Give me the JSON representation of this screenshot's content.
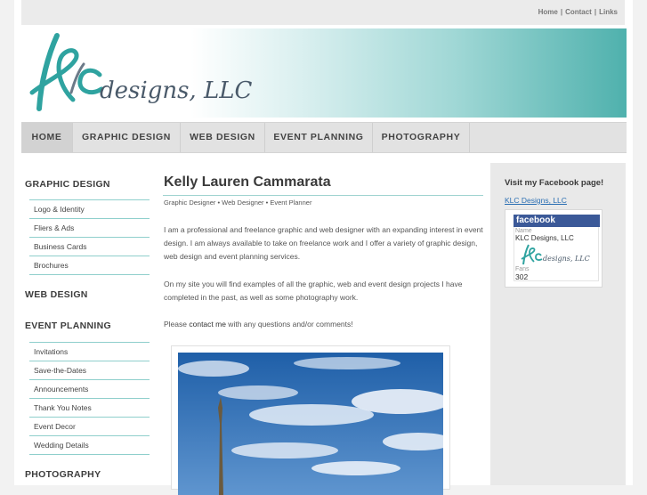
{
  "top_links": [
    "Home",
    "Contact",
    "Links"
  ],
  "logo": {
    "text": "designs, LLC",
    "letters": "KLC"
  },
  "colors": {
    "accent": "#3aa7a3",
    "facebook": "#3b5998",
    "link": "#2b6fb3"
  },
  "nav": [
    "HOME",
    "GRAPHIC DESIGN",
    "WEB DESIGN",
    "EVENT PLANNING",
    "PHOTOGRAPHY"
  ],
  "sidebar": {
    "graphic_design": {
      "heading": "GRAPHIC DESIGN",
      "items": [
        "Logo & Identity",
        "Fliers & Ads",
        "Business Cards",
        "Brochures"
      ]
    },
    "web_design": {
      "heading": "WEB DESIGN"
    },
    "event_planning": {
      "heading": "EVENT PLANNING",
      "items": [
        "Invitations",
        "Save-the-Dates",
        "Announcements",
        "Thank You Notes",
        "Event Decor",
        "Wedding Details"
      ]
    },
    "photography": {
      "heading": "PHOTOGRAPHY"
    }
  },
  "main": {
    "title": "Kelly Lauren Cammarata",
    "subtitle": "Graphic Designer • Web Designer • Event Planner",
    "para1": "I am a professional and freelance graphic and web designer with an expanding interest in event design. I am always available to take on freelance work and I offer a variety of graphic design, web design and event planning services.",
    "para2": "On my site you will find examples of all the graphic, web and event design projects I have completed in the past, as well as some photography work.",
    "para3": {
      "before": "Please ",
      "link": "contact me",
      "after": " with any questions and/or comments!"
    }
  },
  "facebook": {
    "title": "Visit my Facebook page!",
    "link": "KLC Designs, LLC",
    "badge_label": "facebook",
    "name_label": "Name",
    "name": "KLC Designs, LLC",
    "logo_text": "designs, LLC",
    "fans_label": "Fans",
    "fans": "302"
  }
}
